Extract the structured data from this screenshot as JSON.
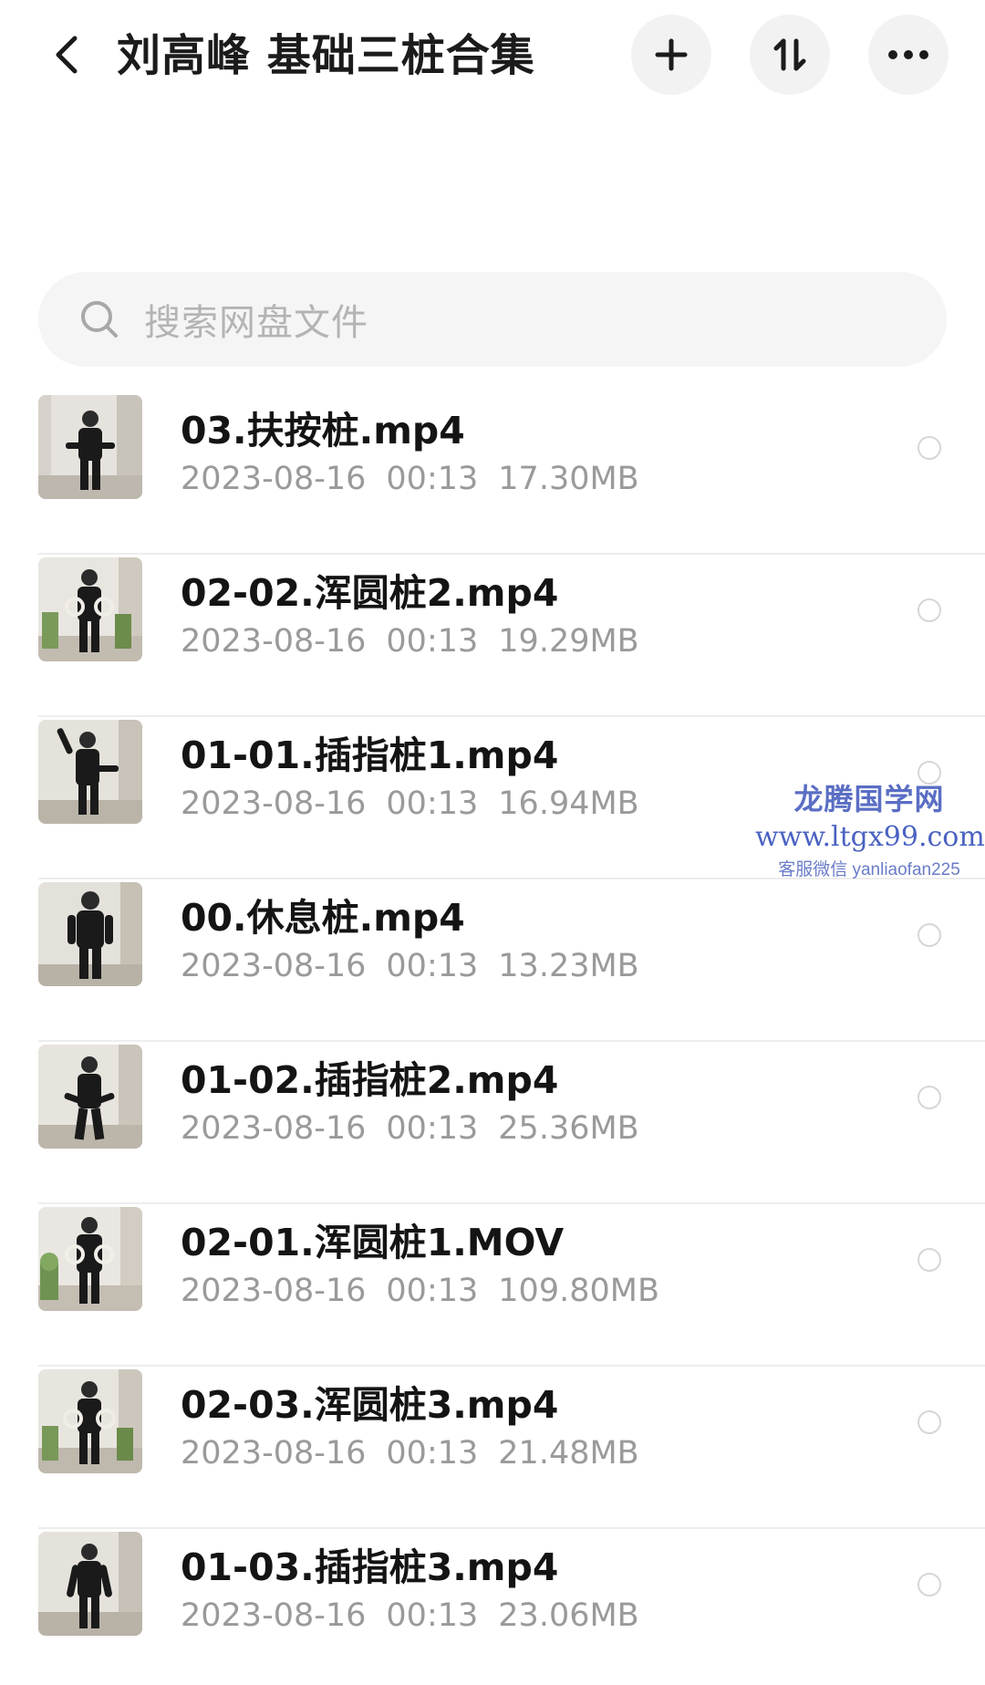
{
  "header": {
    "title": "刘高峰 基础三桩合集",
    "back_icon": "chevron-left-icon",
    "actions": [
      {
        "icon": "plus-icon"
      },
      {
        "icon": "sort-icon"
      },
      {
        "icon": "more-icon"
      }
    ]
  },
  "search": {
    "icon": "search-icon",
    "placeholder": "搜索网盘文件"
  },
  "files": [
    {
      "name": "03.扶按桩.mp4",
      "date": "2023-08-16",
      "time": "00:13",
      "size": "17.30MB"
    },
    {
      "name": "02-02.浑圆桩2.mp4",
      "date": "2023-08-16",
      "time": "00:13",
      "size": "19.29MB"
    },
    {
      "name": "01-01.插指桩1.mp4",
      "date": "2023-08-16",
      "time": "00:13",
      "size": "16.94MB"
    },
    {
      "name": "00.休息桩.mp4",
      "date": "2023-08-16",
      "time": "00:13",
      "size": "13.23MB"
    },
    {
      "name": "01-02.插指桩2.mp4",
      "date": "2023-08-16",
      "time": "00:13",
      "size": "25.36MB"
    },
    {
      "name": "02-01.浑圆桩1.MOV",
      "date": "2023-08-16",
      "time": "00:13",
      "size": "109.80MB"
    },
    {
      "name": "02-03.浑圆桩3.mp4",
      "date": "2023-08-16",
      "time": "00:13",
      "size": "21.48MB"
    },
    {
      "name": "01-03.插指桩3.mp4",
      "date": "2023-08-16",
      "time": "00:13",
      "size": "23.06MB"
    }
  ],
  "watermark": {
    "title": "龙腾国学网",
    "url": "www.ltgx99.com",
    "contact": "客服微信 yanliaofan225"
  },
  "colors": {
    "background": "#ffffff",
    "title_text": "#1b1b1b",
    "meta_text": "#9a9a9a",
    "button_bg": "#f2f2f2",
    "search_bg": "#f5f5f5",
    "watermark": "#4a62c2"
  }
}
